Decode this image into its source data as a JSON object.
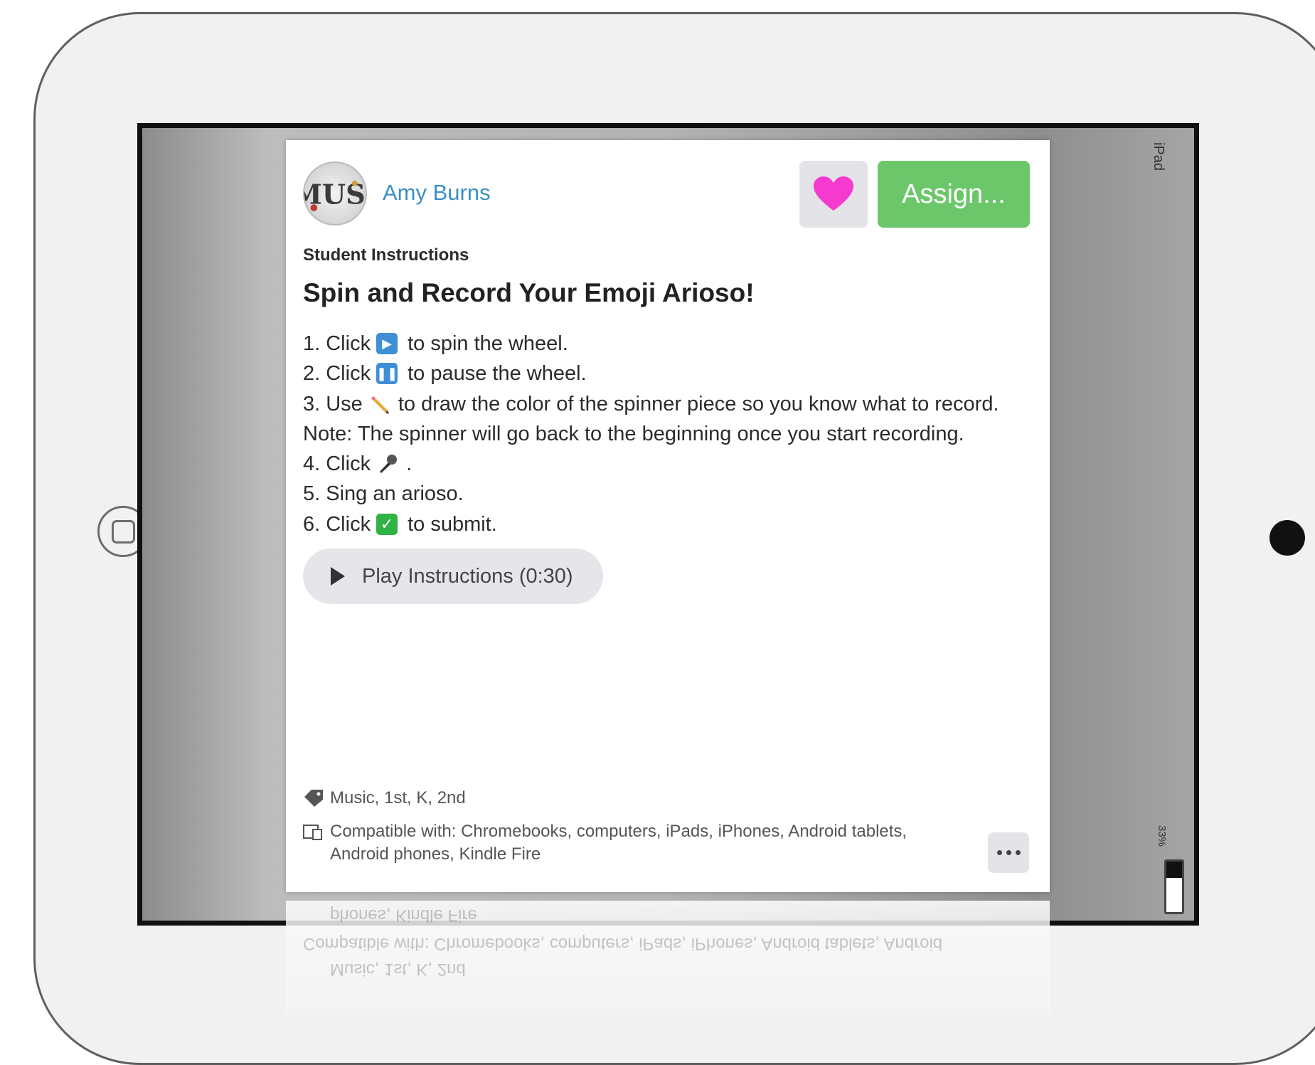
{
  "device": {
    "label": "iPad",
    "battery_text": "33%",
    "battery_level": 0.33
  },
  "card": {
    "author": "Amy Burns",
    "assign_label": "Assign...",
    "section_label": "Student Instructions",
    "title": "Spin and Record Your Emoji Arioso!",
    "steps": [
      {
        "before": "1. Click",
        "icon": "play-button-emoji",
        "after": "to spin the wheel."
      },
      {
        "before": "2. Click",
        "icon": "pause-button-emoji",
        "after": "to pause the wheel."
      },
      {
        "before": "3. Use",
        "icon": "pencil-emoji",
        "after": "to draw the color of the spinner piece so you know what to record."
      },
      {
        "before": "Note: The spinner will go back to the beginning once you start recording.",
        "icon": "",
        "after": ""
      },
      {
        "before": "4. Click",
        "icon": "microphone-emoji",
        "after": "."
      },
      {
        "before": "5. Sing an arioso.",
        "icon": "",
        "after": ""
      },
      {
        "before": "6. Click",
        "icon": "check-mark-emoji",
        "after": "to submit."
      }
    ],
    "play_instructions_label": "Play Instructions (0:30)",
    "tags": "Music, 1st, K, 2nd",
    "compatible": "Compatible with: Chromebooks, computers, iPads, iPhones, Android tablets, Android phones, Kindle Fire",
    "compatible_line2": "phones, Kindle Fire",
    "compatible_line1": "Compatible with: Chromebooks, computers, iPads, iPhones, Android tablets, Android"
  },
  "colors": {
    "author_link": "#3a8fc7",
    "assign_button": "#6cc76a",
    "heart": "#f53ad0"
  }
}
